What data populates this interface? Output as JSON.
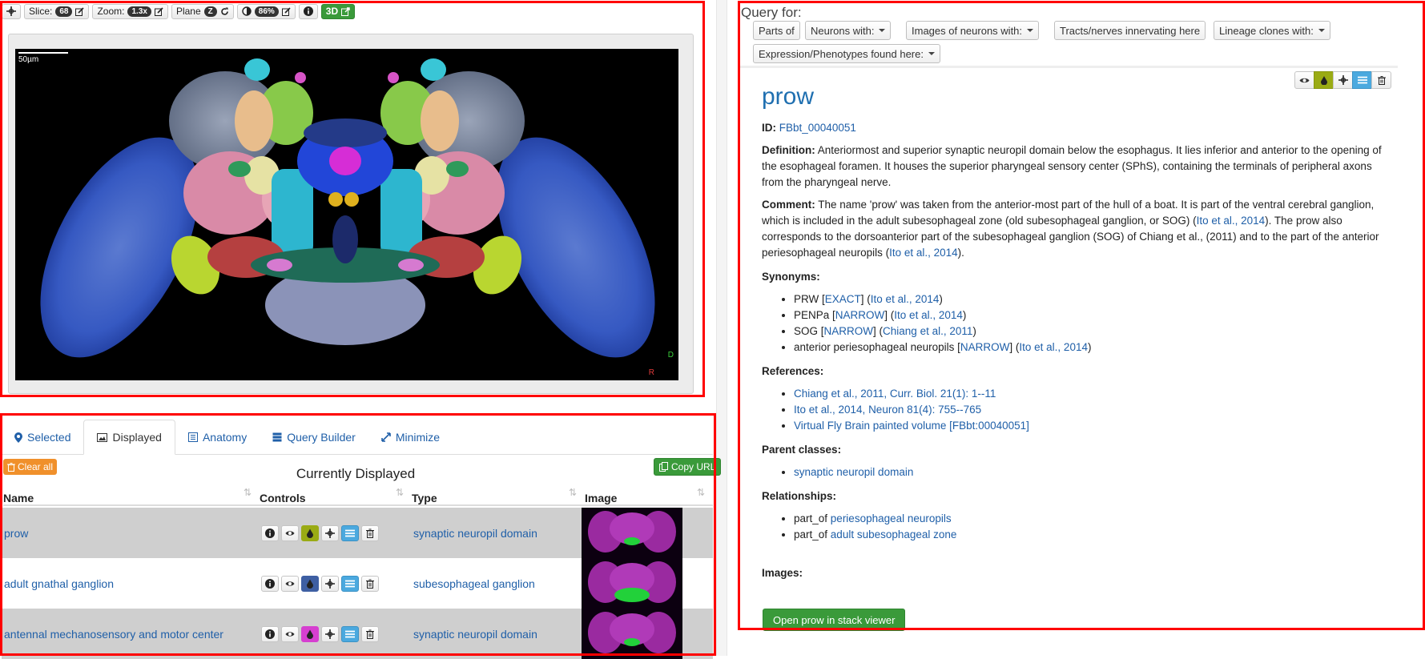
{
  "toolbar": {
    "slice_label": "Slice:",
    "slice_value": "68",
    "zoom_label": "Zoom:",
    "zoom_value": "1.3x",
    "plane_label": "Plane",
    "plane_value": "Z",
    "opacity_value": "86%",
    "threed_label": "3D"
  },
  "viewer": {
    "scale_label": "50µm",
    "axis_d": "D",
    "axis_r": "R"
  },
  "tabs": [
    {
      "label": "Selected",
      "icon": "map-marker-icon"
    },
    {
      "label": "Displayed",
      "icon": "image-icon"
    },
    {
      "label": "Anatomy",
      "icon": "list-icon"
    },
    {
      "label": "Query Builder",
      "icon": "tasks-icon"
    },
    {
      "label": "Minimize",
      "icon": "resize-icon"
    }
  ],
  "displayed": {
    "clear_all_label": "Clear all",
    "copy_url_label": "Copy URL",
    "title": "Currently Displayed",
    "columns": [
      "Name",
      "Controls",
      "Type",
      "Image"
    ],
    "rows": [
      {
        "name": "prow",
        "type": "synaptic neuropil domain",
        "color": "#9aab14"
      },
      {
        "name": "adult gnathal ganglion",
        "type": "subesophageal ganglion",
        "color": "#3e5fa3"
      },
      {
        "name": "antennal mechanosensory and motor center",
        "type": "synaptic neuropil domain",
        "color": "#d63fd0"
      }
    ]
  },
  "query": {
    "label": "Query for:",
    "buttons": [
      {
        "label": "Parts of",
        "dropdown": false
      },
      {
        "label": "Neurons with:",
        "dropdown": true
      },
      {
        "label": "Images of neurons with:",
        "dropdown": true
      },
      {
        "label": "Tracts/nerves innervating here",
        "dropdown": false
      },
      {
        "label": "Lineage clones with:",
        "dropdown": true
      },
      {
        "label": "Expression/Phenotypes found here:",
        "dropdown": true
      }
    ]
  },
  "term": {
    "title": "prow",
    "id_label": "ID:",
    "id_value": "FBbt_00040051",
    "definition_label": "Definition:",
    "definition_text": "Anteriormost and superior synaptic neuropil domain below the esophagus. It lies inferior and anterior to the opening of the esophageal foramen. It houses the superior pharyngeal sensory center (SPhS), containing the terminals of peripheral axons from the pharyngeal nerve.",
    "comment_label": "Comment:",
    "comment_part1": "The name 'prow' was taken from the anterior-most part of the hull of a boat. It is part of the ventral cerebral ganglion, which is included in the adult subesophageal zone (old subesophageal ganglion, or SOG) (",
    "comment_ref1": "Ito et al., 2014",
    "comment_part2": "). The prow also corresponds to the dorsoanterior part of the subesophageal ganglion (SOG) of Chiang et al., (2011) and to the part of the anterior periesophageal neuropils (",
    "comment_ref2": "Ito et al., 2014",
    "comment_part3": ").",
    "synonyms_label": "Synonyms:",
    "synonyms": [
      {
        "name": "PRW",
        "scope": "EXACT",
        "ref": "Ito et al., 2014"
      },
      {
        "name": "PENPa",
        "scope": "NARROW",
        "ref": "Ito et al., 2014"
      },
      {
        "name": "SOG",
        "scope": "NARROW",
        "ref": "Chiang et al., 2011"
      },
      {
        "name": "anterior periesophageal neuropils",
        "scope": "NARROW",
        "ref": "Ito et al., 2014"
      }
    ],
    "references_label": "References:",
    "references": [
      "Chiang et al., 2011, Curr. Biol. 21(1): 1--11",
      "Ito et al., 2014, Neuron 81(4): 755--765",
      "Virtual Fly Brain painted volume [FBbt:00040051]"
    ],
    "parents_label": "Parent classes:",
    "parents": [
      "synaptic neuropil domain"
    ],
    "relationships_label": "Relationships:",
    "relationships": [
      {
        "rel": "part_of",
        "target": "periesophageal neuropils"
      },
      {
        "rel": "part_of",
        "target": "adult subesophageal zone"
      }
    ],
    "images_label": "Images:",
    "open_button": "Open prow in stack viewer"
  },
  "colors": {
    "accent": "#1f6fb0",
    "success": "#3a9a3a",
    "warning": "#f0902b",
    "outline": "#ff0000"
  }
}
